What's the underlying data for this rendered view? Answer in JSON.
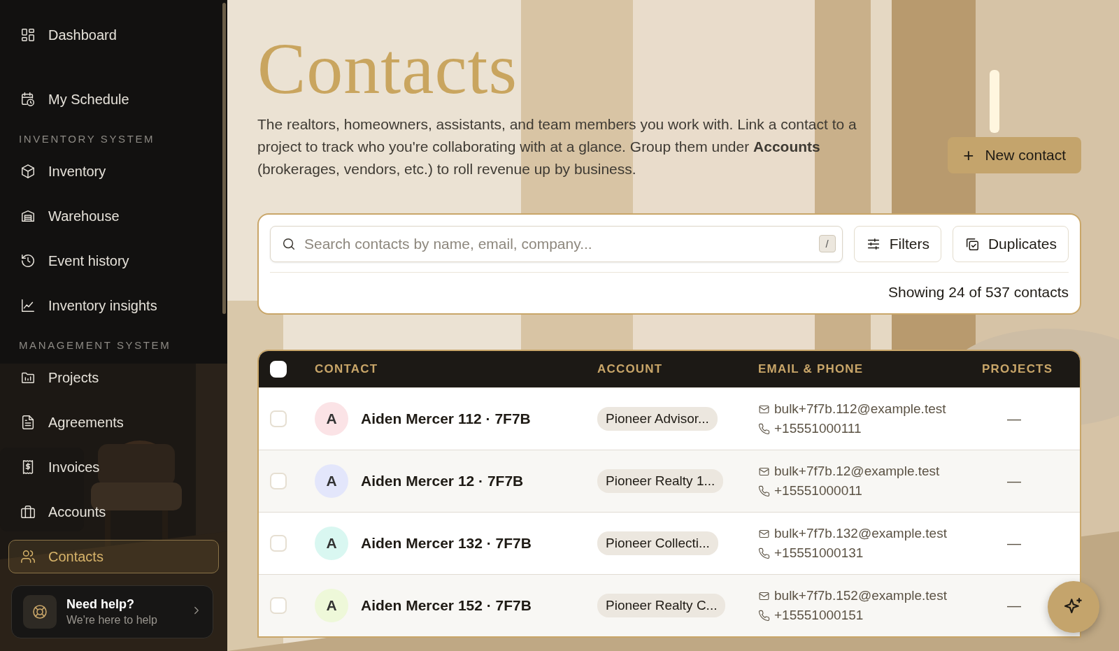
{
  "sidebar": {
    "sections": [
      {
        "items": [
          {
            "label": "Dashboard",
            "selected": false
          },
          {
            "label": "My Schedule",
            "selected": false
          }
        ]
      },
      {
        "heading": "INVENTORY SYSTEM",
        "items": [
          {
            "label": "Inventory",
            "selected": false
          },
          {
            "label": "Warehouse",
            "selected": false
          },
          {
            "label": "Event history",
            "selected": false
          },
          {
            "label": "Inventory insights",
            "selected": false
          }
        ]
      },
      {
        "heading": "MANAGEMENT SYSTEM",
        "items": [
          {
            "label": "Projects",
            "selected": false
          },
          {
            "label": "Agreements",
            "selected": false
          },
          {
            "label": "Invoices",
            "selected": false
          },
          {
            "label": "Accounts",
            "selected": false
          },
          {
            "label": "Contacts",
            "selected": true
          }
        ]
      }
    ],
    "help": {
      "title": "Need help?",
      "subtitle": "We're here to help"
    }
  },
  "page": {
    "title": "Contacts",
    "description": "The realtors, homeowners, assistants, and team members you work with. Link a contact to a project to track who you're collaborating with at a glance. Group them under **Accounts** (brokerages, vendors, etc.) to roll revenue up by business.",
    "new_button": {
      "icon": "+",
      "label": "New contact"
    }
  },
  "toolbar": {
    "search": {
      "placeholder": "Search contacts by name, email, company...",
      "shortcut": "/"
    },
    "buttons": [
      {
        "label": "Filters"
      },
      {
        "label": "Duplicates"
      }
    ],
    "summary": "Showing 24 of 537 contacts"
  },
  "table": {
    "select_all": {
      "checked": false
    },
    "columns": [
      "CONTACT",
      "ACCOUNT",
      "EMAIL & PHONE",
      "PROJECTS"
    ],
    "rows": [
      {
        "checked": false,
        "initial": "A",
        "color": "#fbe3e6",
        "name": "Aiden Mercer 112 · 7F7B",
        "account": "Pioneer Advisor...",
        "email": "bulk+7f7b.112@example.test",
        "phone": "+15551000111",
        "projects": "—"
      },
      {
        "checked": false,
        "initial": "A",
        "color": "#e3e6fb",
        "name": "Aiden Mercer 12 · 7F7B",
        "account": "Pioneer Realty 1...",
        "email": "bulk+7f7b.12@example.test",
        "phone": "+15551000011",
        "projects": "—"
      },
      {
        "checked": false,
        "initial": "A",
        "color": "#d9f7f1",
        "name": "Aiden Mercer 132 · 7F7B",
        "account": "Pioneer Collecti...",
        "email": "bulk+7f7b.132@example.test",
        "phone": "+15551000131",
        "projects": "—"
      },
      {
        "checked": false,
        "initial": "A",
        "color": "#eef8d9",
        "name": "Aiden Mercer 152 · 7F7B",
        "account": "Pioneer Realty C...",
        "email": "bulk+7f7b.152@example.test",
        "phone": "+15551000151",
        "projects": "—"
      }
    ]
  }
}
